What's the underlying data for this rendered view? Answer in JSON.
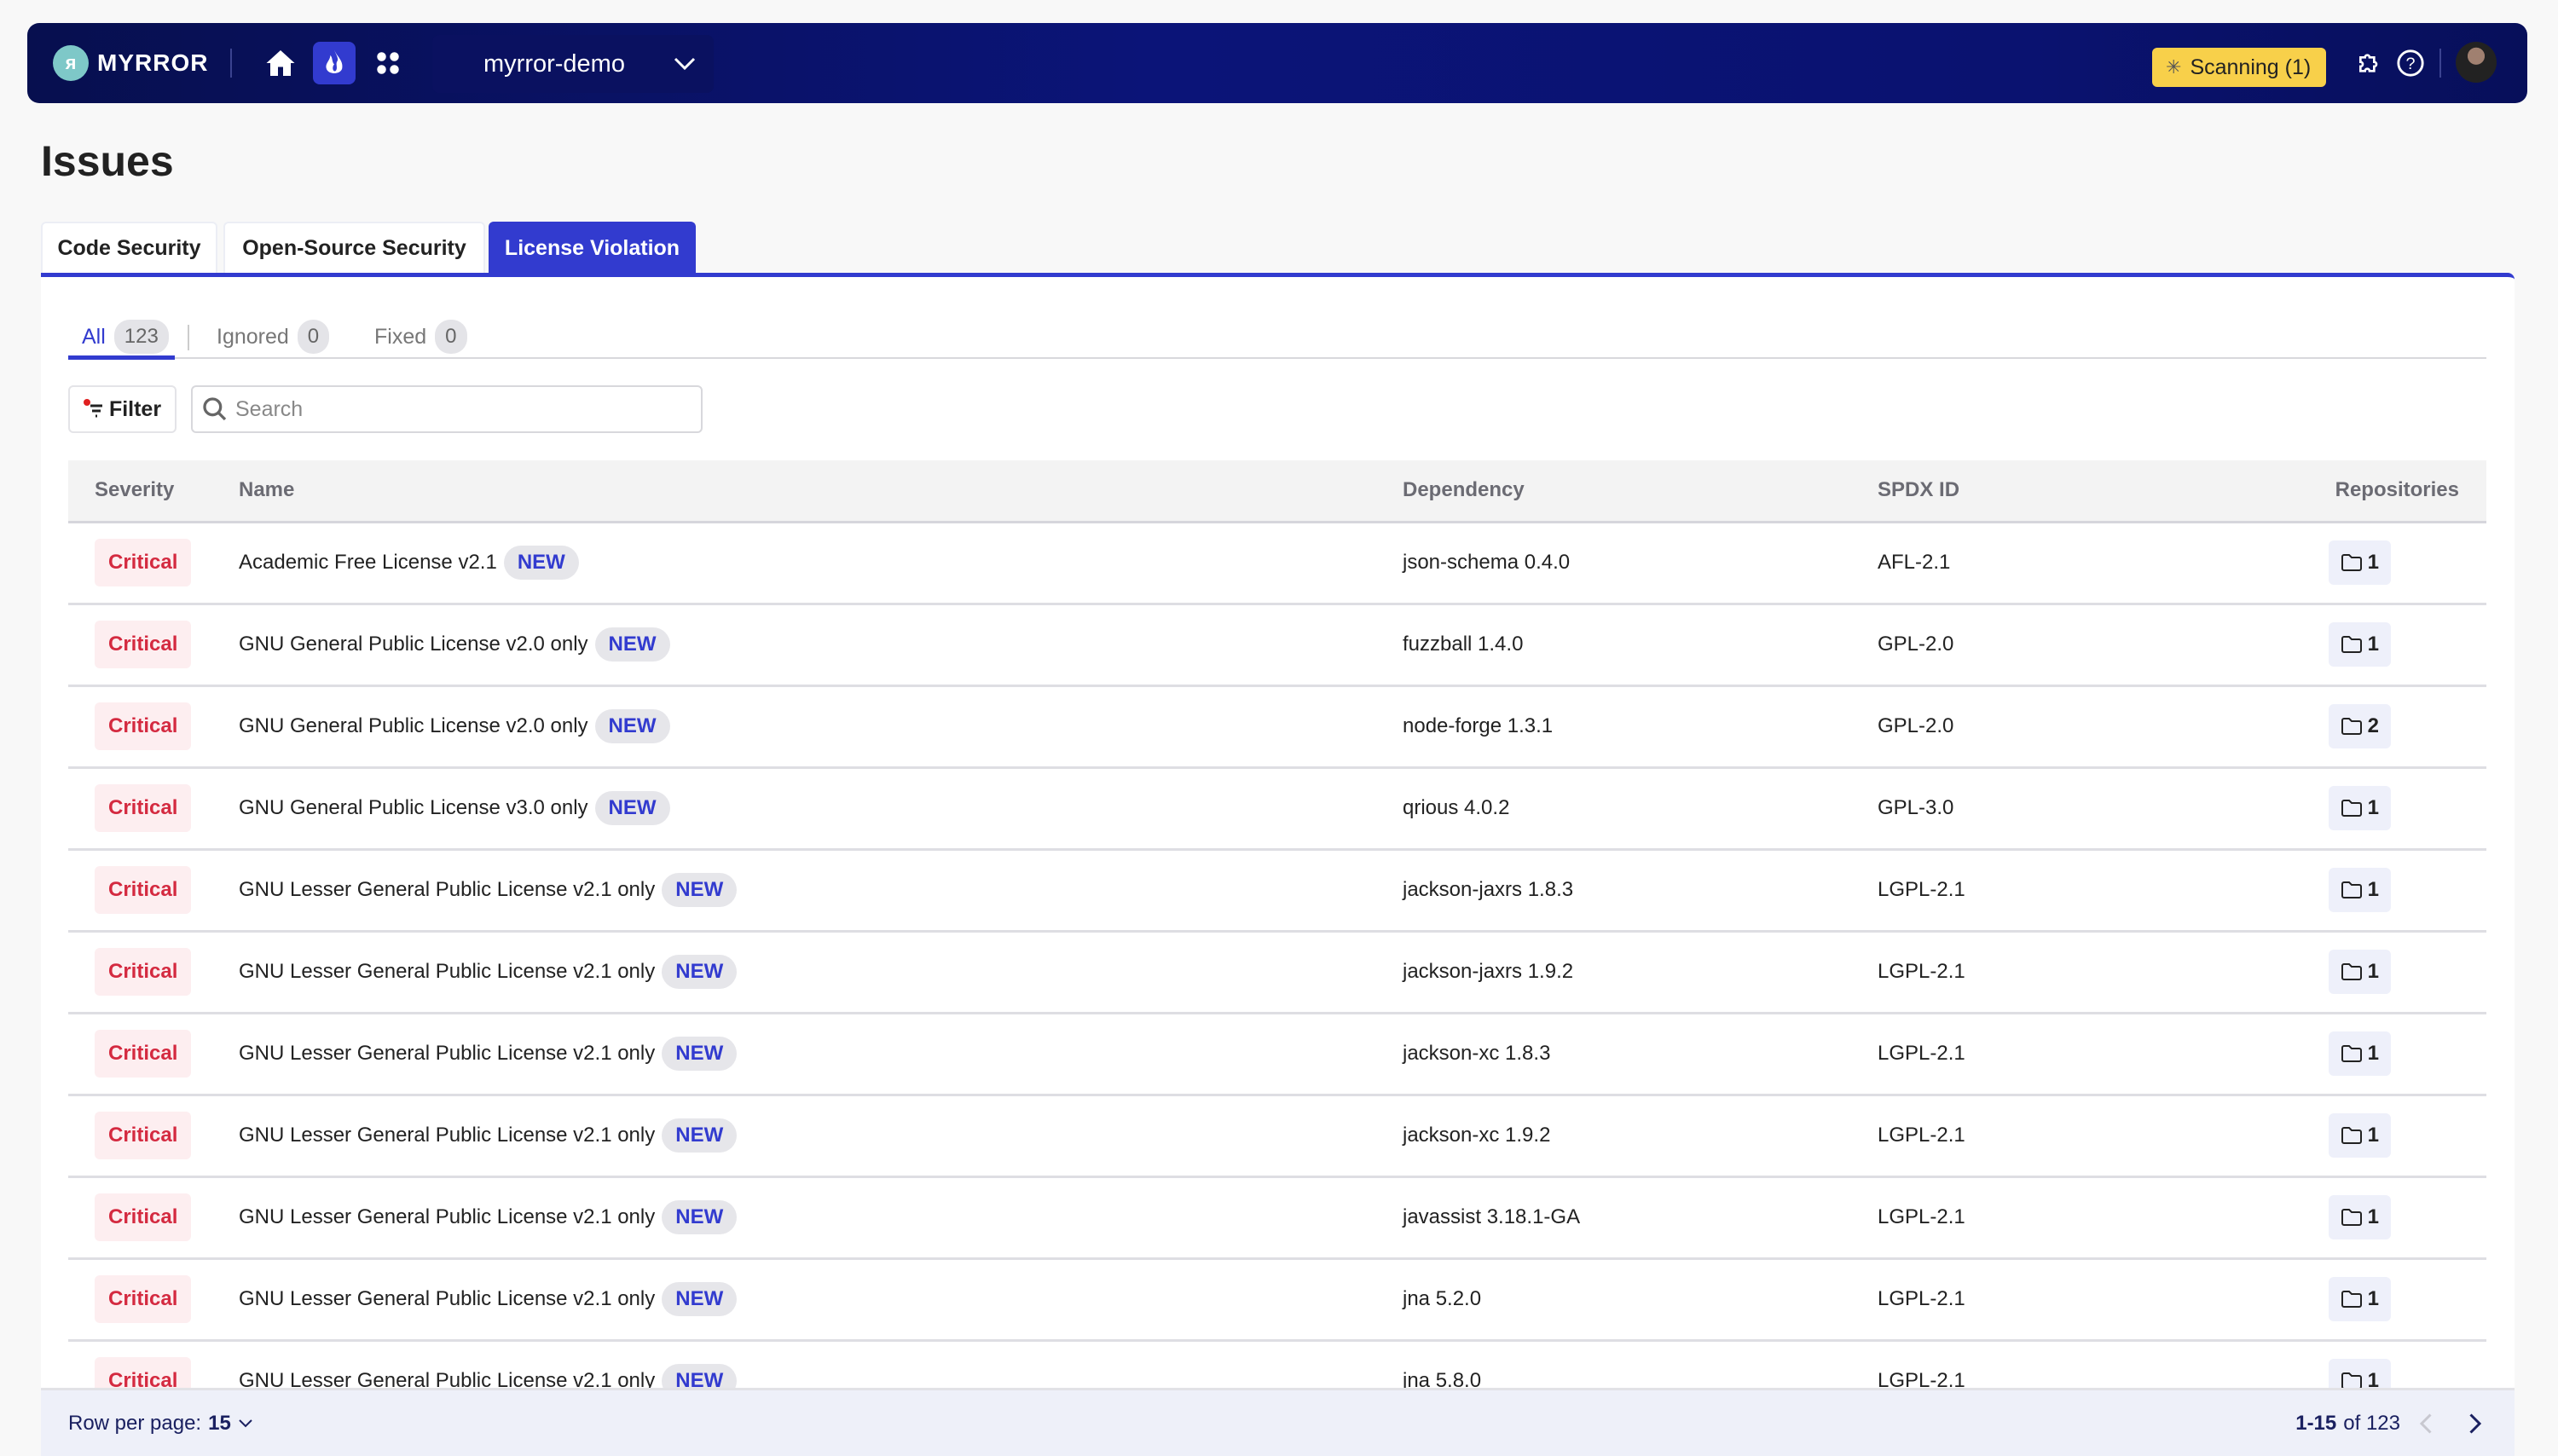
{
  "nav": {
    "brand": "MYRROR",
    "project": "myrror-demo",
    "scanning": "Scanning (1)"
  },
  "page": {
    "title": "Issues"
  },
  "tabs": [
    {
      "label": "Code Security"
    },
    {
      "label": "Open-Source Security"
    },
    {
      "label": "License Violation",
      "active": true
    }
  ],
  "subtabs": [
    {
      "label": "All",
      "count": "123"
    },
    {
      "label": "Ignored",
      "count": "0"
    },
    {
      "label": "Fixed",
      "count": "0"
    }
  ],
  "toolbar": {
    "filter": "Filter",
    "search_placeholder": "Search"
  },
  "table": {
    "headers": [
      "Severity",
      "Name",
      "Dependency",
      "SPDX ID",
      "Repositories"
    ],
    "new_badge": "NEW",
    "rows": [
      {
        "severity": "Critical",
        "name": "Academic Free License v2.1",
        "dependency": "json-schema 0.4.0",
        "spdx": "AFL-2.1",
        "repos": "1"
      },
      {
        "severity": "Critical",
        "name": "GNU General Public License v2.0 only",
        "dependency": "fuzzball 1.4.0",
        "spdx": "GPL-2.0",
        "repos": "1"
      },
      {
        "severity": "Critical",
        "name": "GNU General Public License v2.0 only",
        "dependency": "node-forge 1.3.1",
        "spdx": "GPL-2.0",
        "repos": "2"
      },
      {
        "severity": "Critical",
        "name": "GNU General Public License v3.0 only",
        "dependency": "qrious 4.0.2",
        "spdx": "GPL-3.0",
        "repos": "1"
      },
      {
        "severity": "Critical",
        "name": "GNU Lesser General Public License v2.1 only",
        "dependency": "jackson-jaxrs 1.8.3",
        "spdx": "LGPL-2.1",
        "repos": "1"
      },
      {
        "severity": "Critical",
        "name": "GNU Lesser General Public License v2.1 only",
        "dependency": "jackson-jaxrs 1.9.2",
        "spdx": "LGPL-2.1",
        "repos": "1"
      },
      {
        "severity": "Critical",
        "name": "GNU Lesser General Public License v2.1 only",
        "dependency": "jackson-xc 1.8.3",
        "spdx": "LGPL-2.1",
        "repos": "1"
      },
      {
        "severity": "Critical",
        "name": "GNU Lesser General Public License v2.1 only",
        "dependency": "jackson-xc 1.9.2",
        "spdx": "LGPL-2.1",
        "repos": "1"
      },
      {
        "severity": "Critical",
        "name": "GNU Lesser General Public License v2.1 only",
        "dependency": "javassist 3.18.1-GA",
        "spdx": "LGPL-2.1",
        "repos": "1"
      },
      {
        "severity": "Critical",
        "name": "GNU Lesser General Public License v2.1 only",
        "dependency": "jna 5.2.0",
        "spdx": "LGPL-2.1",
        "repos": "1"
      },
      {
        "severity": "Critical",
        "name": "GNU Lesser General Public License v2.1 only",
        "dependency": "jna 5.8.0",
        "spdx": "LGPL-2.1",
        "repos": "1"
      }
    ]
  },
  "footer": {
    "rows_label": "Row per page:",
    "rows_value": "15",
    "range": "1-15",
    "of": "of 123"
  }
}
